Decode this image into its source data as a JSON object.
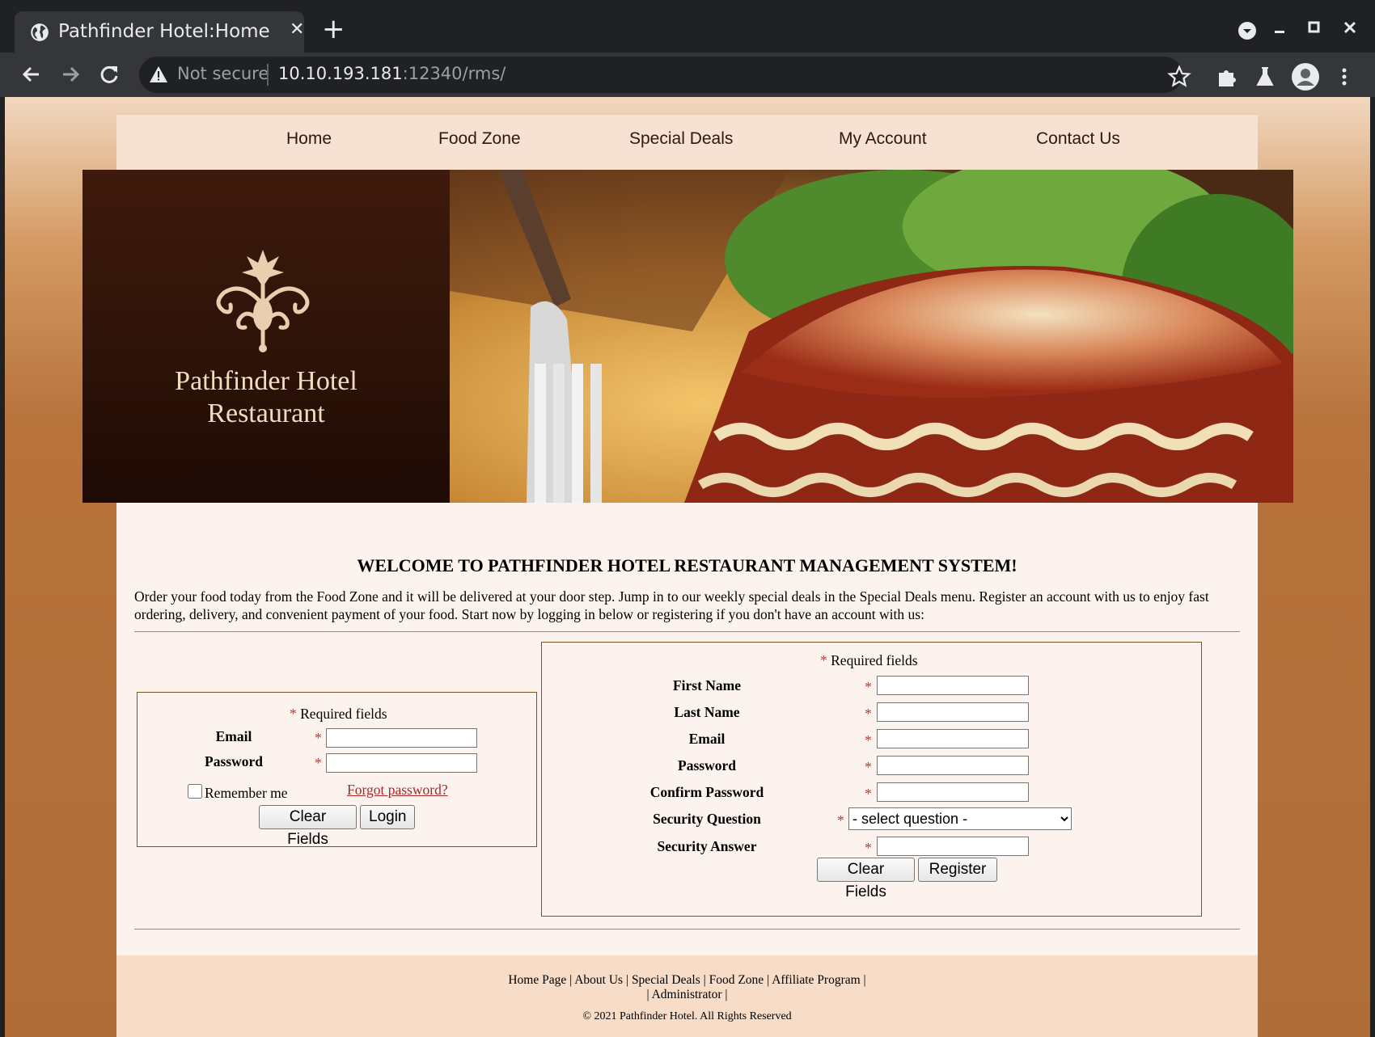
{
  "browser": {
    "tab_title": "Pathfinder Hotel:Home",
    "tab_close": "✕",
    "new_tab": "+",
    "security_label": "Not secure",
    "url_host": "10.10.193.181",
    "url_rest": ":12340/rms/"
  },
  "nav": {
    "items": [
      "Home",
      "Food Zone",
      "Special Deals",
      "My Account",
      "Contact Us"
    ]
  },
  "banner": {
    "name_line1": "Pathfinder Hotel",
    "name_line2": "Restaurant"
  },
  "welcome": {
    "heading": "WELCOME TO PATHFINDER HOTEL RESTAURANT MANAGEMENT SYSTEM!",
    "intro": "Order your food today from the Food Zone and it will be delivered at your door step. Jump in to our weekly special deals in the Special Deals menu. Register an account with us to enjoy fast ordering, delivery, and convenient payment of your food. Start now by logging in below or registering if you don't have an account with us:"
  },
  "login": {
    "required_star": "*",
    "required_text": " Required fields",
    "email_label": "Email",
    "password_label": "Password",
    "remember_label": "Remember me",
    "forgot_link": "Forgot password?",
    "clear_button": "Clear Fields",
    "login_button": "Login"
  },
  "register": {
    "required_star": "*",
    "required_text": " Required fields",
    "fields": [
      "First Name",
      "Last Name",
      "Email",
      "Password",
      "Confirm Password",
      "Security Question",
      "Security Answer"
    ],
    "security_question_selected": "- select question -",
    "clear_button": "Clear Fields",
    "register_button": "Register"
  },
  "footer": {
    "links": [
      "Home Page",
      "About Us",
      "Special Deals",
      "Food Zone",
      "Affiliate Program",
      "Administrator"
    ],
    "copyright": "© 2021 Pathfinder Hotel. All Rights Reserved"
  },
  "colors": {
    "browser_bg": "#202124",
    "nav_bg": "#f7e1d2",
    "banner_dark": "#2a120a",
    "required_star": "#c0392b",
    "link_red": "#a52a2a",
    "page_orange": "#b06d38"
  },
  "icons": {
    "tab": "globe-icon",
    "address": "warning-triangle-icon",
    "toolbar": [
      "back-arrow-icon",
      "forward-arrow-icon",
      "reload-icon",
      "star-icon",
      "puzzle-extension-icon",
      "flask-icon",
      "profile-avatar-icon",
      "kebab-menu-icon"
    ]
  }
}
